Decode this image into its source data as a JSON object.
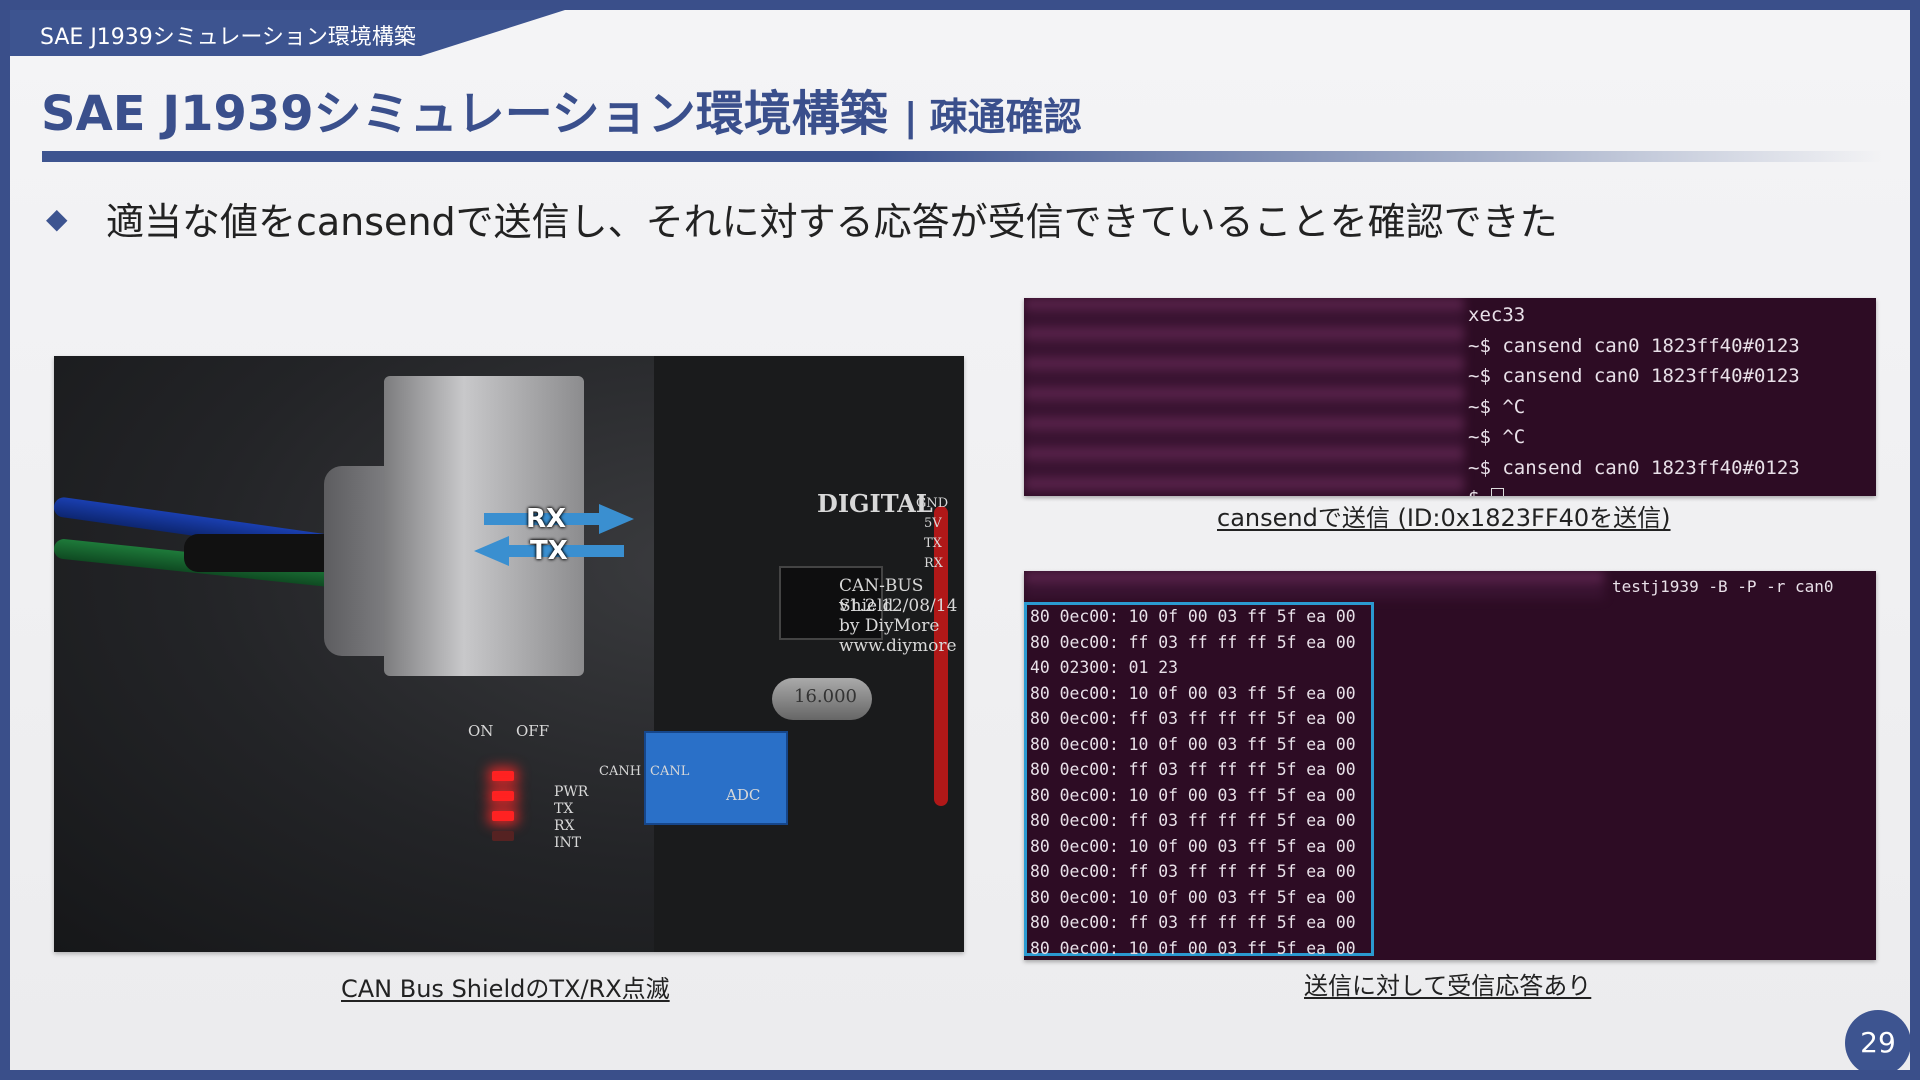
{
  "header": {
    "tab_label": "SAE J1939シミュレーション環境構築",
    "title": "SAE J1939シミュレーション環境構築",
    "separator": "|",
    "subtitle": "疎通確認"
  },
  "bullet": {
    "marker": "◆",
    "text": "適当な値をcansendで送信し、それに対する応答が受信できていることを確認できた"
  },
  "photo": {
    "arrow_rx": "RX",
    "arrow_tx": "TX",
    "silkscreen": {
      "digital": "DIGITAL",
      "shield": "CAN-BUS Shield",
      "version": "v1.2 12/08/14",
      "by": "by DiyMore",
      "url": "www.diymore",
      "off": "OFF",
      "on": "ON",
      "led_labels": [
        "PWR",
        "TX",
        "RX",
        "INT"
      ],
      "canh": "CANH",
      "canl": "CANL",
      "adc": "ADC",
      "crystal": "16.000",
      "pins": [
        "GND",
        "5V",
        "TX",
        "RX"
      ]
    },
    "caption": "CAN Bus ShieldのTX/RX点滅"
  },
  "terminal_send": {
    "lines": [
      "xec33",
      "~$ cansend can0 1823ff40#0123",
      "~$ cansend can0 1823ff40#0123",
      "~$ ^C",
      "~$ ^C",
      "~$ cansend can0 1823ff40#0123",
      "$ "
    ],
    "caption": "cansendで送信 (ID:0x1823FF40を送信)"
  },
  "terminal_recv": {
    "command": "testj1939 -B -P -r can0",
    "lines": [
      "80 0ec00: 10 0f 00 03 ff 5f ea 00",
      "80 0ec00: ff 03 ff ff ff 5f ea 00",
      "40 02300: 01 23",
      "80 0ec00: 10 0f 00 03 ff 5f ea 00",
      "80 0ec00: ff 03 ff ff ff 5f ea 00",
      "80 0ec00: 10 0f 00 03 ff 5f ea 00",
      "80 0ec00: ff 03 ff ff ff 5f ea 00",
      "80 0ec00: 10 0f 00 03 ff 5f ea 00",
      "80 0ec00: ff 03 ff ff ff 5f ea 00",
      "80 0ec00: 10 0f 00 03 ff 5f ea 00",
      "80 0ec00: ff 03 ff ff ff 5f ea 00",
      "80 0ec00: 10 0f 00 03 ff 5f ea 00",
      "80 0ec00: ff 03 ff ff ff 5f ea 00",
      "80 0ec00: 10 0f 00 03 ff 5f ea 00"
    ],
    "caption": "送信に対して受信応答あり"
  },
  "page_number": "29",
  "colors": {
    "accent": "#3d5490",
    "terminal_bg": "#2d0c24",
    "highlight_box": "#2b9ad1",
    "arrow": "#3a8fd0"
  }
}
